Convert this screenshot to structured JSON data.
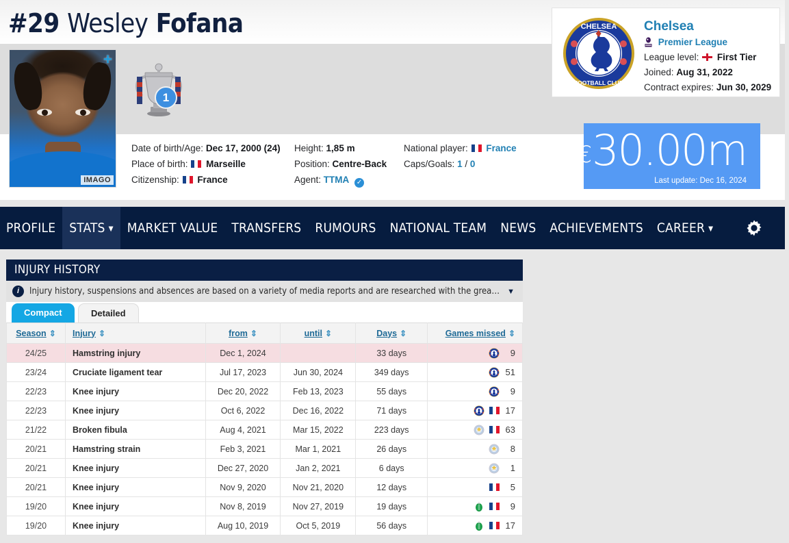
{
  "player": {
    "shirt_number": "#29",
    "first_name": "Wesley",
    "last_name": "Fofana",
    "photo_credit": "IMAGO",
    "add_icon": "+",
    "trophy_count": "1"
  },
  "details": {
    "col1": [
      {
        "label": "Date of birth/Age:",
        "value": "Dec 17, 2000 (24)"
      },
      {
        "label": "Place of birth:",
        "value": "Marseille",
        "flag": "france"
      },
      {
        "label": "Citizenship:",
        "value": "France",
        "flag": "france"
      }
    ],
    "col2": [
      {
        "label": "Height:",
        "value": "1,85 m"
      },
      {
        "label": "Position:",
        "value": "Centre-Back"
      },
      {
        "label": "Agent:",
        "value": "TTMA",
        "link": true,
        "verified": true
      }
    ],
    "col3": [
      {
        "label": "National player:",
        "value": "France",
        "flag": "france",
        "link": true
      },
      {
        "label": "Caps/Goals:",
        "caps": "1",
        "sep": " / ",
        "goals": "0"
      }
    ]
  },
  "club": {
    "name": "Chelsea",
    "league": "Premier League",
    "league_level_label": "League level:",
    "league_level_value": "First Tier",
    "joined_label": "Joined:",
    "joined_value": "Aug 31, 2022",
    "contract_label": "Contract expires:",
    "contract_value": "Jun 30, 2029"
  },
  "market_value": {
    "currency": "€",
    "amount": "30.00m",
    "last_update": "Last update: Dec 16, 2024"
  },
  "nav": {
    "items": [
      {
        "label": "PROFILE",
        "active": false,
        "caret": false
      },
      {
        "label": "STATS",
        "active": true,
        "caret": true
      },
      {
        "label": "MARKET VALUE",
        "active": false,
        "caret": false
      },
      {
        "label": "TRANSFERS",
        "active": false,
        "caret": false
      },
      {
        "label": "RUMOURS",
        "active": false,
        "caret": false
      },
      {
        "label": "NATIONAL TEAM",
        "active": false,
        "caret": false
      },
      {
        "label": "NEWS",
        "active": false,
        "caret": false
      },
      {
        "label": "ACHIEVEMENTS",
        "active": false,
        "caret": false
      },
      {
        "label": "CAREER",
        "active": false,
        "caret": true
      }
    ],
    "settings_icon": "gear-icon"
  },
  "injury_history": {
    "title": "INJURY HISTORY",
    "info_text": "Injury history, suspensions and absences are based on a variety of media reports and are researched with the greatest of care. If you should n...",
    "info_icon": "i",
    "tabs": [
      {
        "label": "Compact",
        "active": true
      },
      {
        "label": "Detailed",
        "active": false
      }
    ],
    "columns": [
      "Season",
      "Injury",
      "from",
      "until",
      "Days",
      "Games missed"
    ],
    "rows": [
      {
        "season": "24/25",
        "injury": "Hamstring injury",
        "from": "Dec 1, 2024",
        "until": "",
        "days": "33 days",
        "games": "9",
        "clubs": [
          "chelsea"
        ],
        "highlight": true
      },
      {
        "season": "23/24",
        "injury": "Cruciate ligament tear",
        "from": "Jul 17, 2023",
        "until": "Jun 30, 2024",
        "days": "349 days",
        "games": "51",
        "clubs": [
          "chelsea"
        ],
        "highlight": false
      },
      {
        "season": "22/23",
        "injury": "Knee injury",
        "from": "Dec 20, 2022",
        "until": "Feb 13, 2023",
        "days": "55 days",
        "games": "9",
        "clubs": [
          "chelsea"
        ],
        "highlight": false
      },
      {
        "season": "22/23",
        "injury": "Knee injury",
        "from": "Oct 6, 2022",
        "until": "Dec 16, 2022",
        "days": "71 days",
        "games": "17",
        "clubs": [
          "chelsea",
          "france"
        ],
        "highlight": false
      },
      {
        "season": "21/22",
        "injury": "Broken fibula",
        "from": "Aug 4, 2021",
        "until": "Mar 15, 2022",
        "days": "223 days",
        "games": "63",
        "clubs": [
          "leicester",
          "france"
        ],
        "highlight": false
      },
      {
        "season": "20/21",
        "injury": "Hamstring strain",
        "from": "Feb 3, 2021",
        "until": "Mar 1, 2021",
        "days": "26 days",
        "games": "8",
        "clubs": [
          "leicester"
        ],
        "highlight": false
      },
      {
        "season": "20/21",
        "injury": "Knee injury",
        "from": "Dec 27, 2020",
        "until": "Jan 2, 2021",
        "days": "6 days",
        "games": "1",
        "clubs": [
          "leicester"
        ],
        "highlight": false
      },
      {
        "season": "20/21",
        "injury": "Knee injury",
        "from": "Nov 9, 2020",
        "until": "Nov 21, 2020",
        "days": "12 days",
        "games": "5",
        "clubs": [
          "france"
        ],
        "highlight": false
      },
      {
        "season": "19/20",
        "injury": "Knee injury",
        "from": "Nov 8, 2019",
        "until": "Nov 27, 2019",
        "days": "19 days",
        "games": "9",
        "clubs": [
          "saintetienne",
          "france"
        ],
        "highlight": false
      },
      {
        "season": "19/20",
        "injury": "Knee injury",
        "from": "Aug 10, 2019",
        "until": "Oct 5, 2019",
        "days": "56 days",
        "games": "17",
        "clubs": [
          "saintetienne",
          "france"
        ],
        "highlight": false
      }
    ]
  },
  "colors": {
    "nav_bg": "#061c3f",
    "nav_active": "#1a3159",
    "market_value_bg": "#559af4",
    "tab_active": "#14a7e4",
    "highlight_row": "#f6dde1",
    "link": "#1f7fb3",
    "title_bg": "#0a1f44"
  }
}
